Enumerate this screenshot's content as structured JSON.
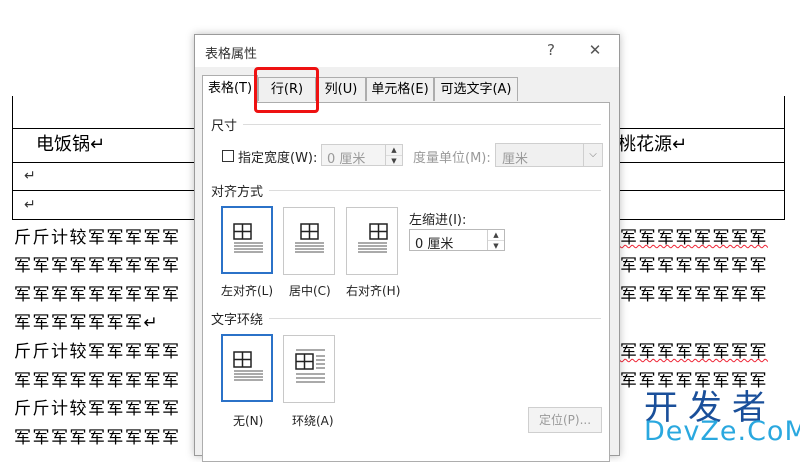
{
  "document": {
    "table_cells": {
      "left_cell": "电饭锅↵",
      "right_cell": "桃花源↵",
      "return_mark": "↵"
    },
    "paragraphs": [
      "斤斤计较军军军军军",
      "军军军军军军军军军",
      "军军军军军军军军军",
      "军军军军军军军↵",
      "斤斤计较军军军军军",
      "军军军军军军军军军",
      "斤斤计较军军军军军",
      "军军军军军军军军军"
    ],
    "right_text_line": "军军军军军军军军"
  },
  "dialog": {
    "title": "表格属性",
    "help_label": "?",
    "close_label": "✕",
    "tabs": [
      {
        "label": "表格(T)",
        "active": true
      },
      {
        "label": "行(R)",
        "active": false
      },
      {
        "label": "列(U)",
        "active": false
      },
      {
        "label": "单元格(E)",
        "active": false
      },
      {
        "label": "可选文字(A)",
        "active": false
      }
    ],
    "size": {
      "section_label": "尺寸",
      "preferred_width_label": "指定宽度(W):",
      "preferred_width_value": "0 厘米",
      "measure_in_label": "度量单位(M):",
      "measure_in_value": "厘米"
    },
    "alignment": {
      "section_label": "对齐方式",
      "options": [
        "左对齐(L)",
        "居中(C)",
        "右对齐(H)"
      ],
      "indent_label": "左缩进(I):",
      "indent_value": "0 厘米"
    },
    "wrapping": {
      "section_label": "文字环绕",
      "options": [
        "无(N)",
        "环绕(A)"
      ],
      "position_button": "定位(P)..."
    }
  },
  "watermark": {
    "cn": "开发者",
    "en": "DevZe.CoM"
  },
  "colors": {
    "highlight": "#ee1111",
    "selected_border": "#2b72c8",
    "spell_underline": "#e23"
  },
  "icons": [
    "help-icon",
    "close-icon",
    "spin-up-icon",
    "spin-down-icon",
    "dropdown-arrow-icon",
    "table-grid-icon"
  ]
}
